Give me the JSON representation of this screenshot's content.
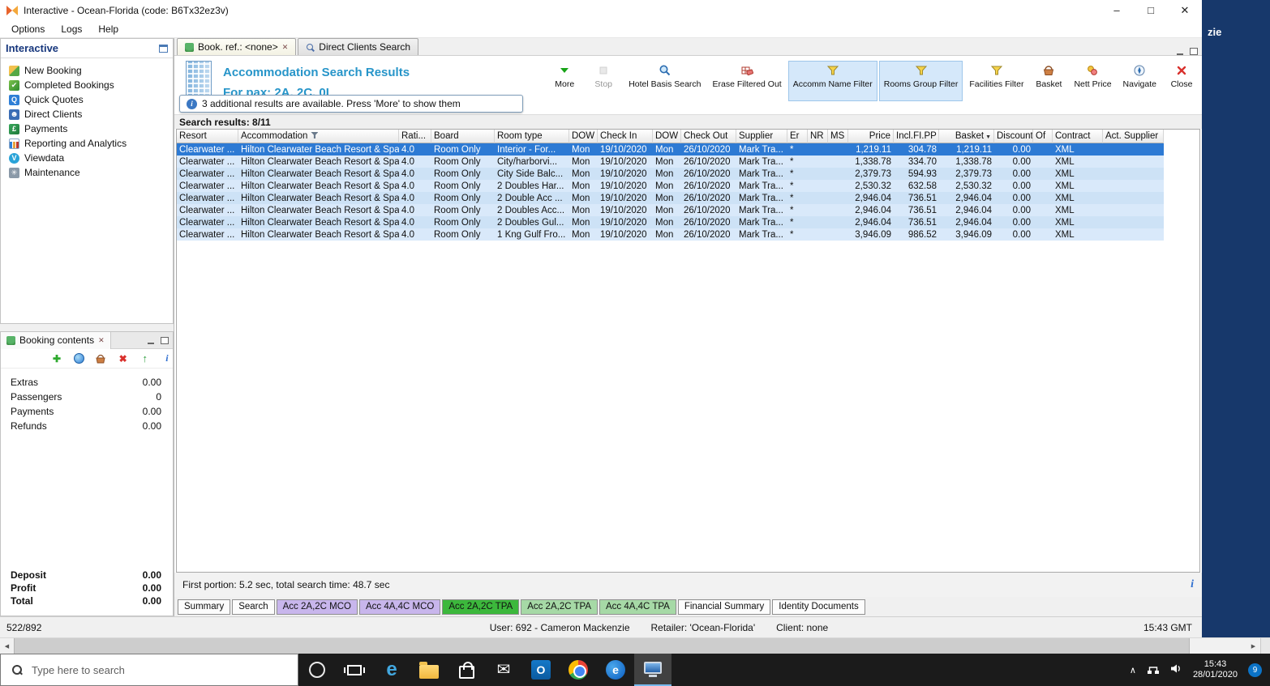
{
  "window": {
    "title": "Interactive - Ocean-Florida (code: B6Tx32ez3v)",
    "menu_items": [
      "Options",
      "Logs",
      "Help"
    ]
  },
  "icons": {
    "minimize": "–",
    "maximize": "□",
    "close": "✕",
    "tab_close": "✕",
    "scroll_left": "◀",
    "scroll_right": "▶",
    "tray_expand": "∧",
    "mail_glyph": "✉",
    "edge_glyph": "e",
    "outlook_glyph": "O",
    "browser_glyph": "e",
    "info_glyph": "i",
    "add_glyph": "✚",
    "delete_glyph": "✖",
    "move_up_glyph": "↑",
    "basket_sort": "▼"
  },
  "sidebar": {
    "title": "Interactive",
    "items": [
      {
        "label": "New Booking",
        "icon": "new-booking-icon"
      },
      {
        "label": "Completed Bookings",
        "icon": "completed-bookings-icon"
      },
      {
        "label": "Quick Quotes",
        "icon": "quick-quotes-icon"
      },
      {
        "label": "Direct Clients",
        "icon": "direct-clients-icon"
      },
      {
        "label": "Payments",
        "icon": "payments-icon"
      },
      {
        "label": "Reporting and Analytics",
        "icon": "reporting-icon"
      },
      {
        "label": "Viewdata",
        "icon": "viewdata-icon"
      },
      {
        "label": "Maintenance",
        "icon": "maintenance-icon"
      }
    ]
  },
  "booking_contents": {
    "title": "Booking contents",
    "rows": [
      {
        "label": "Extras",
        "value": "0.00"
      },
      {
        "label": "Passengers",
        "value": "0"
      },
      {
        "label": "Payments",
        "value": "0.00"
      },
      {
        "label": "Refunds",
        "value": "0.00"
      }
    ],
    "totals": [
      {
        "label": "Deposit",
        "value": "0.00"
      },
      {
        "label": "Profit",
        "value": "0.00"
      },
      {
        "label": "Total",
        "value": "0.00"
      }
    ]
  },
  "doc_tabs": [
    {
      "label": "Book. ref.: <none>",
      "icon": "palm-icon",
      "active": true,
      "closable": true
    },
    {
      "label": "Direct Clients Search",
      "icon": "search-icon",
      "active": false,
      "closable": false
    }
  ],
  "results_header": {
    "title": "Accommodation Search Results",
    "subtitle": "For pax: 2A, 2C, 0I",
    "info_message": "3 additional results are available. Press 'More' to show them",
    "results_count": "Search results: 8/11",
    "timing": "First portion: 5.2 sec, total search time: 48.7 sec"
  },
  "toolbar_buttons": [
    {
      "label": "More",
      "icon": "more-icon",
      "state": "normal"
    },
    {
      "label": "Stop",
      "icon": "stop-icon",
      "state": "disabled"
    },
    {
      "label": "Hotel Basis Search",
      "icon": "hotel-basis-search-icon",
      "state": "normal"
    },
    {
      "label": "Erase Filtered Out",
      "icon": "erase-filtered-icon",
      "state": "normal"
    },
    {
      "label": "Accomm Name Filter",
      "icon": "filter-icon",
      "state": "active"
    },
    {
      "label": "Rooms Group Filter",
      "icon": "filter-icon",
      "state": "active"
    },
    {
      "label": "Facilities Filter",
      "icon": "filter-icon",
      "state": "normal"
    },
    {
      "label": "Basket",
      "icon": "basket-icon",
      "state": "normal"
    },
    {
      "label": "Nett Price",
      "icon": "nett-price-icon",
      "state": "normal"
    },
    {
      "label": "Navigate",
      "icon": "navigate-icon",
      "state": "normal"
    },
    {
      "label": "Close",
      "icon": "close-icon",
      "state": "normal"
    }
  ],
  "results_table": {
    "selected_index": 0,
    "columns": [
      {
        "label": "Resort"
      },
      {
        "label": "Accommodation",
        "filter": true
      },
      {
        "label": "Rati..."
      },
      {
        "label": "Board"
      },
      {
        "label": "Room type"
      },
      {
        "label": "DOW"
      },
      {
        "label": "Check In"
      },
      {
        "label": "DOW"
      },
      {
        "label": "Check Out"
      },
      {
        "label": "Supplier"
      },
      {
        "label": "Er"
      },
      {
        "label": "NR"
      },
      {
        "label": "MS"
      },
      {
        "label": "Price"
      },
      {
        "label": "Incl.FI.PP"
      },
      {
        "label": "Basket",
        "sort": "desc"
      },
      {
        "label": "Discount"
      },
      {
        "label": "Of"
      },
      {
        "label": "Contract"
      },
      {
        "label": "Act. Supplier"
      }
    ],
    "rows": [
      [
        "Clearwater ...",
        "Hilton Clearwater Beach Resort & Spa",
        "4.0",
        "Room Only",
        "Interior - For...",
        "Mon",
        "19/10/2020",
        "Mon",
        "26/10/2020",
        "Mark Tra...",
        "*",
        "",
        "",
        "1,219.11",
        "304.78",
        "1,219.11",
        "0.00",
        "",
        "XML",
        ""
      ],
      [
        "Clearwater ...",
        "Hilton Clearwater Beach Resort & Spa",
        "4.0",
        "Room Only",
        "City/harborvi...",
        "Mon",
        "19/10/2020",
        "Mon",
        "26/10/2020",
        "Mark Tra...",
        "*",
        "",
        "",
        "1,338.78",
        "334.70",
        "1,338.78",
        "0.00",
        "",
        "XML",
        ""
      ],
      [
        "Clearwater ...",
        "Hilton Clearwater Beach Resort & Spa",
        "4.0",
        "Room Only",
        "City Side Balc...",
        "Mon",
        "19/10/2020",
        "Mon",
        "26/10/2020",
        "Mark Tra...",
        "*",
        "",
        "",
        "2,379.73",
        "594.93",
        "2,379.73",
        "0.00",
        "",
        "XML",
        ""
      ],
      [
        "Clearwater ...",
        "Hilton Clearwater Beach Resort & Spa",
        "4.0",
        "Room Only",
        "2 Doubles Har...",
        "Mon",
        "19/10/2020",
        "Mon",
        "26/10/2020",
        "Mark Tra...",
        "*",
        "",
        "",
        "2,530.32",
        "632.58",
        "2,530.32",
        "0.00",
        "",
        "XML",
        ""
      ],
      [
        "Clearwater ...",
        "Hilton Clearwater Beach Resort & Spa",
        "4.0",
        "Room Only",
        "2 Double Acc ...",
        "Mon",
        "19/10/2020",
        "Mon",
        "26/10/2020",
        "Mark Tra...",
        "*",
        "",
        "",
        "2,946.04",
        "736.51",
        "2,946.04",
        "0.00",
        "",
        "XML",
        ""
      ],
      [
        "Clearwater ...",
        "Hilton Clearwater Beach Resort & Spa",
        "4.0",
        "Room Only",
        "2 Doubles Acc...",
        "Mon",
        "19/10/2020",
        "Mon",
        "26/10/2020",
        "Mark Tra...",
        "*",
        "",
        "",
        "2,946.04",
        "736.51",
        "2,946.04",
        "0.00",
        "",
        "XML",
        ""
      ],
      [
        "Clearwater ...",
        "Hilton Clearwater Beach Resort & Spa",
        "4.0",
        "Room Only",
        "2 Doubles Gul...",
        "Mon",
        "19/10/2020",
        "Mon",
        "26/10/2020",
        "Mark Tra...",
        "*",
        "",
        "",
        "2,946.04",
        "736.51",
        "2,946.04",
        "0.00",
        "",
        "XML",
        ""
      ],
      [
        "Clearwater ...",
        "Hilton Clearwater Beach Resort & Spa",
        "4.0",
        "Room Only",
        "1 Kng Gulf Fro...",
        "Mon",
        "19/10/2020",
        "Mon",
        "26/10/2020",
        "Mark Tra...",
        "*",
        "",
        "",
        "3,946.09",
        "986.52",
        "3,946.09",
        "0.00",
        "",
        "XML",
        ""
      ]
    ]
  },
  "bottom_tabs": [
    {
      "label": "Summary",
      "variant": "plain"
    },
    {
      "label": "Search",
      "variant": "plain"
    },
    {
      "label": "Acc 2A,2C MCO",
      "variant": "purple"
    },
    {
      "label": "Acc 4A,4C MCO",
      "variant": "purple"
    },
    {
      "label": "Acc 2A,2C TPA",
      "variant": "green-active"
    },
    {
      "label": "Acc 2A,2C TPA",
      "variant": "green"
    },
    {
      "label": "Acc 4A,4C TPA",
      "variant": "green"
    },
    {
      "label": "Financial Summary",
      "variant": "plain"
    },
    {
      "label": "Identity Documents",
      "variant": "plain"
    }
  ],
  "status_bar": {
    "pager": "522/892",
    "user": "User: 692 - Cameron Mackenzie",
    "retailer": "Retailer: 'Ocean-Florida'",
    "client": "Client: none",
    "time": "15:43 GMT"
  },
  "taskbar": {
    "search_placeholder": "Type here to search",
    "clock_time": "15:43",
    "clock_date": "28/01/2020",
    "notification_count": "9"
  },
  "background_window": {
    "visible_text": "zie"
  }
}
